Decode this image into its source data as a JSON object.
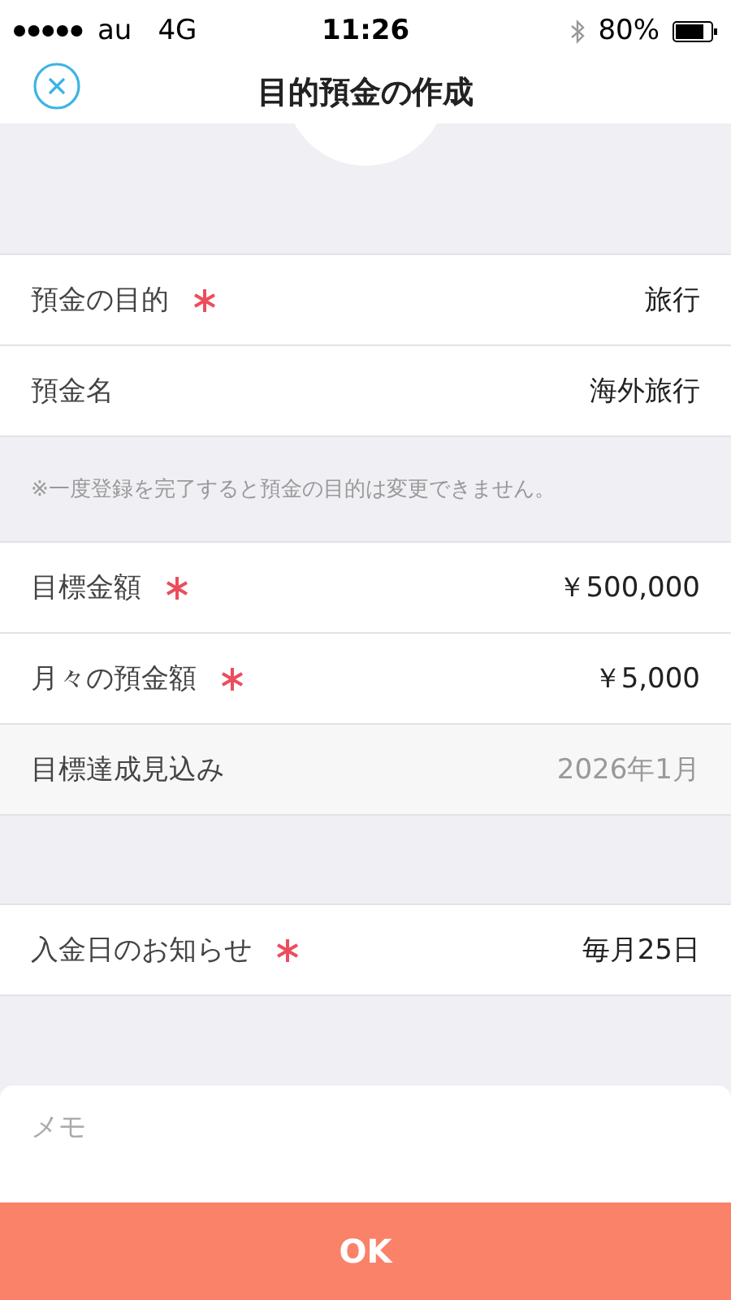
{
  "status_bar": {
    "carrier": "au",
    "network": "4G",
    "time": "11:26",
    "battery": "80%"
  },
  "nav": {
    "title": "目的預金の作成"
  },
  "sections": [
    {
      "rows": [
        {
          "label": "預金の目的",
          "value": "旅行",
          "required": true,
          "disabled": false
        },
        {
          "label": "預金名",
          "value": "海外旅行",
          "required": false,
          "disabled": false
        }
      ],
      "note": "※一度登録を完了すると預金の目的は変更できません。"
    },
    {
      "rows": [
        {
          "label": "目標金額",
          "value": "￥500,000",
          "required": true,
          "disabled": false
        },
        {
          "label": "月々の預金額",
          "value": "￥5,000",
          "required": true,
          "disabled": false
        },
        {
          "label": "目標達成見込み",
          "value": "2026年1月",
          "required": false,
          "disabled": true
        }
      ]
    },
    {
      "rows": [
        {
          "label": "入金日のお知らせ",
          "value": "毎月25日",
          "required": true,
          "disabled": false
        }
      ]
    }
  ],
  "memo": {
    "placeholder": "メモ"
  },
  "button": "OK"
}
